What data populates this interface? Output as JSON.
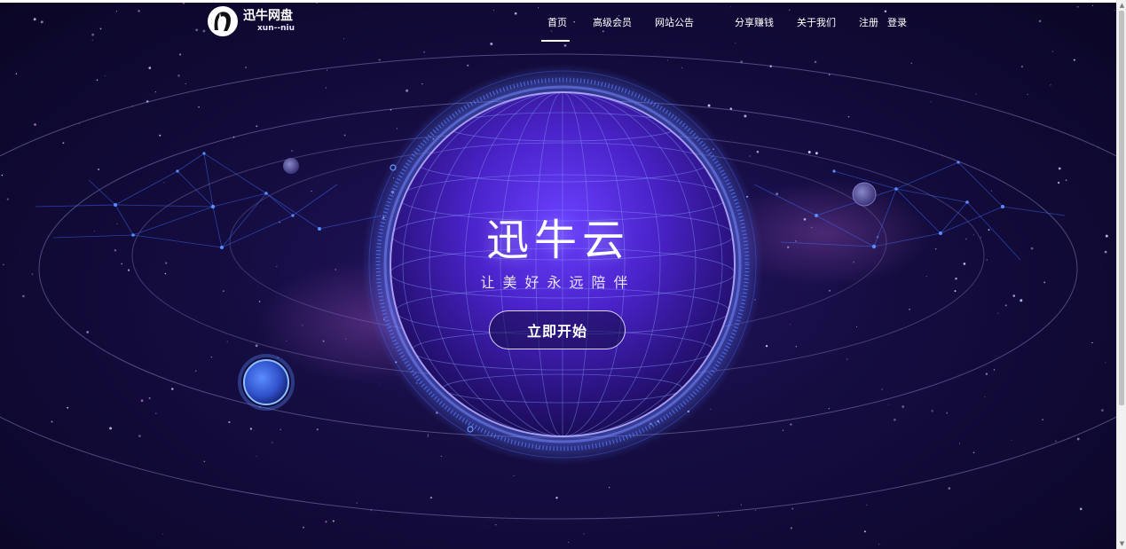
{
  "header": {
    "logo_name": "迅牛网盘",
    "logo_sub": "xun--niu",
    "nav": [
      {
        "label": "首页",
        "active": true
      },
      {
        "label": "高级会员"
      },
      {
        "label": "网站公告"
      },
      {
        "label": "分享赚钱"
      },
      {
        "label": "关于我们"
      },
      {
        "label": "注册"
      },
      {
        "label": "登录"
      }
    ]
  },
  "hero": {
    "title": "迅牛云",
    "subtitle": "让美好永远陪伴",
    "button_label": "立即开始"
  },
  "colors": {
    "background": "#120b3a",
    "globe": "#5a2ee0",
    "grid_line": "#7a9cff",
    "orbit": "#9a96d8",
    "text": "#ffffff"
  },
  "icons": {
    "logo": "bull-head-logo-icon",
    "scroll_up": "scroll-up-arrow-icon",
    "scroll_down": "scroll-down-arrow-icon"
  }
}
